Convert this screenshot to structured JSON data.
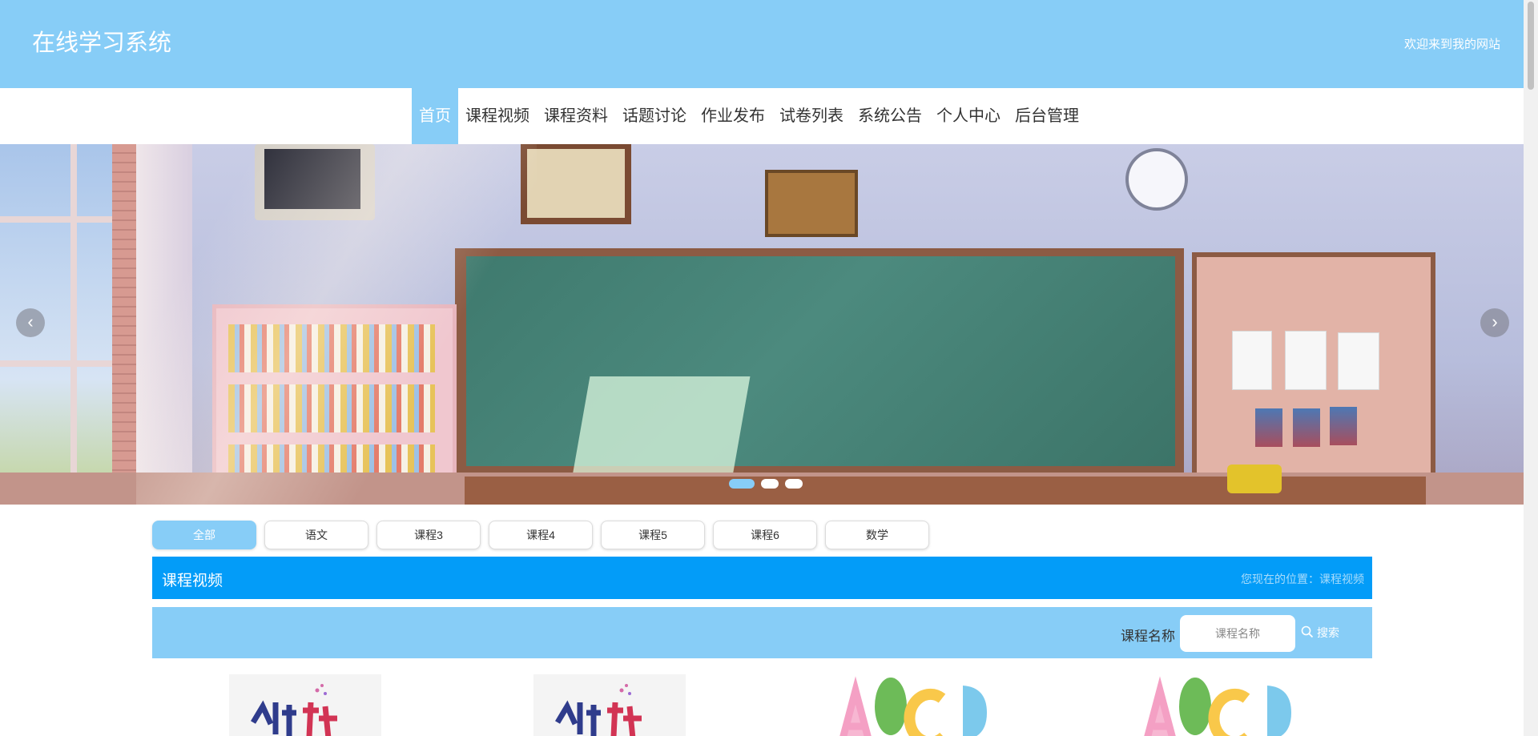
{
  "header": {
    "site_title": "在线学习系统",
    "welcome": "欢迎来到我的网站"
  },
  "nav": {
    "items": [
      {
        "label": "首页",
        "active": true
      },
      {
        "label": "课程视频"
      },
      {
        "label": "课程资料"
      },
      {
        "label": "话题讨论"
      },
      {
        "label": "作业发布"
      },
      {
        "label": "试卷列表"
      },
      {
        "label": "系统公告"
      },
      {
        "label": "个人中心"
      },
      {
        "label": "后台管理"
      }
    ]
  },
  "banner": {
    "prev_icon": "chevron-left-icon",
    "next_icon": "chevron-right-icon",
    "prev_glyph": "‹",
    "next_glyph": "›",
    "slides": 3,
    "active_slide": 1
  },
  "categories": [
    {
      "label": "全部",
      "active": true
    },
    {
      "label": "语文"
    },
    {
      "label": "课程3"
    },
    {
      "label": "课程4"
    },
    {
      "label": "课程5"
    },
    {
      "label": "课程6"
    },
    {
      "label": "数学"
    }
  ],
  "section": {
    "title": "课程视频",
    "breadcrumb": "您现在的位置：课程视频"
  },
  "search": {
    "label": "课程名称",
    "placeholder": "课程名称",
    "value": "",
    "button_label": "搜索",
    "button_icon": "search-icon"
  },
  "colors": {
    "primary_light": "#87cdf7",
    "primary": "#039cf8"
  }
}
